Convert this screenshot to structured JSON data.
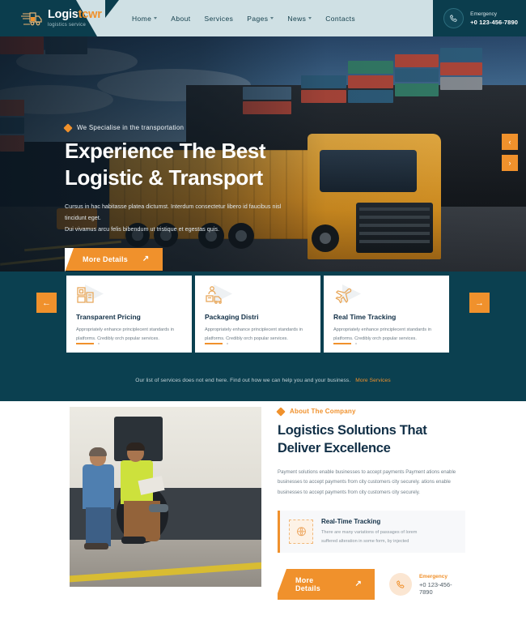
{
  "header": {
    "brand": {
      "name_dark": "Logis",
      "name_accent": "tcwr",
      "tagline": "logistics service",
      "icon": "truck-icon"
    },
    "nav": [
      {
        "label": "Home",
        "has_dropdown": true
      },
      {
        "label": "About",
        "has_dropdown": false
      },
      {
        "label": "Services",
        "has_dropdown": false
      },
      {
        "label": "Pages",
        "has_dropdown": true
      },
      {
        "label": "News",
        "has_dropdown": true
      },
      {
        "label": "Contacts",
        "has_dropdown": false
      }
    ],
    "emergency": {
      "label": "Emergency",
      "number": "+0 123-456-7890",
      "icon": "phone-icon"
    }
  },
  "hero": {
    "tag": "We Specialise in the transportation",
    "title_line1": "Experience The Best",
    "title_line2": "Logistic & Transport",
    "desc_line1": "Cursus in hac habitasse platea dictumst. Interdum consectetur libero id faucibus nisl tincidunt eget.",
    "desc_line2": "Dui vivamus arcu felis bibendum ut tristique et egestas quis.",
    "cta": "More Details",
    "cta_icon": "arrow-up-right-icon",
    "prev_icon": "chevron-left-icon",
    "next_icon": "chevron-right-icon"
  },
  "services": {
    "prev_icon": "arrow-left-icon",
    "next_icon": "arrow-right-icon",
    "cards": [
      {
        "icon": "package-box-icon",
        "title": "Transparent Pricing",
        "desc": "Appropriately enhance principlecent standards in platforms. Credibly orch popular services."
      },
      {
        "icon": "packaging-worker-icon",
        "title": "Packaging Distri",
        "desc": "Appropriately enhance principlecent standards in platforms. Credibly orch popular services."
      },
      {
        "icon": "airplane-icon",
        "title": "Real Time Tracking",
        "desc": "Appropriately enhance principlecent standards in platforms. Credibly orch popular services."
      }
    ],
    "note": "Our list of services does not end here. Find out how we can help you and your business.",
    "note_link": "More Services"
  },
  "about": {
    "photo_alt": "two-men-inspecting-truck-photo",
    "tag": "About The Company",
    "tag_icon": "diamond-icon",
    "title_line1": "Logistics Solutions That",
    "title_line2": "Deliver Excellence",
    "desc": "Payment solutions enable businesses to accept payments Payment ations enable businesses to accept payments from city customers city securely. ations enable businesses to accept payments from city customers city securely.",
    "feature": {
      "icon": "globe-tracking-icon",
      "title": "Real-Time Tracking",
      "desc_line1": "There are many variations of passages of lorem",
      "desc_line2": "suffered alteration in some form, by injected"
    },
    "cta": "More Details",
    "cta_icon": "arrow-up-right-icon",
    "emergency": {
      "label": "Emergency",
      "number": "+0 123-456-7890",
      "icon": "phone-icon"
    }
  },
  "colors": {
    "accent_orange": "#f0912c",
    "brand_teal": "#0b4050",
    "header_teal": "#0b3d4d",
    "nav_light": "#cfe0e4",
    "heading_navy": "#123047"
  }
}
